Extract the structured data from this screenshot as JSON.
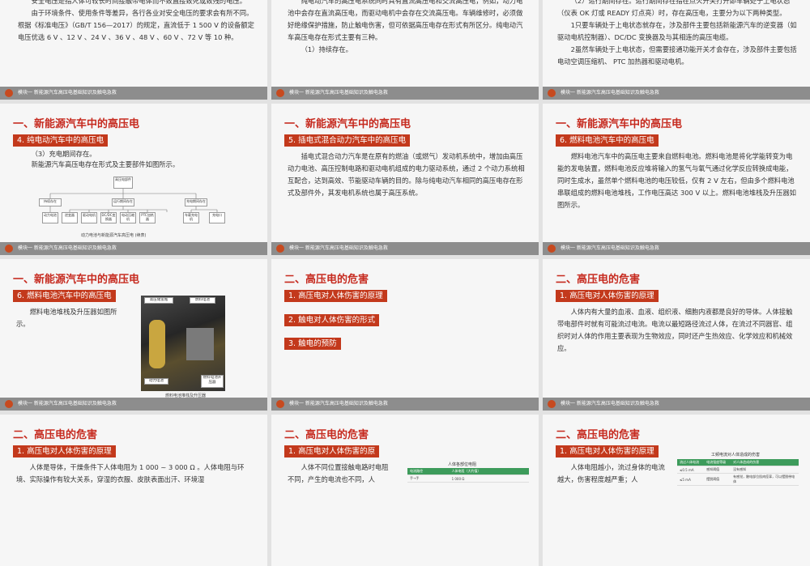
{
  "footer_text": "模块一 新能源汽车高压电基础知识及触电急救",
  "s1": {
    "p1": "安全电压是指人体可较长时间接触带电体而不致直接致死或致残的电压。",
    "p2": "由于环境条件、使用条件等差异，各行各业对安全电压的要求会有所不同。根据《标准电压》（GB/T 156—2017）的规定，直流低于 1 500 V 的设备额定电压优选 6 V 、12 V 、24 V 、36 V 、48 V 、60 V 、72 V 等 10 种。"
  },
  "s2": {
    "p1": "纯电动汽车的高压电系统同时具有直流高压电和交流高压电，例如，动力电池中会存在直流高压电，而驱动电机中会存在交流高压电。车辆维修时，必须做好绝缘保护措施，防止触电伤害，但可依据高压电存在形式有所区分。纯电动汽车高压电存在形式主要有三种。",
    "p2": "（1）持续存在。"
  },
  "s3": {
    "p1": "（2）运行期间存在。运行期间存在指在点火开关打开即车辆处于上电状态（仪表 OK 灯或 READY 灯点亮）时，存在高压电，主要分为以下两种类型。",
    "p2": "1只要车辆处于上电状态就存在，涉及部件主要包括新能源汽车的逆变器（如驱动电机控制器）、DC/DC 变换器及与其相连的高压电缆。",
    "p3": "2虽然车辆处于上电状态，但需要接通功能开关才会存在，涉及部件主要包括电动空调压缩机、 PTC 加热器和驱动电机。"
  },
  "s4": {
    "title": "一、新能源汽车中的高压电",
    "tag": "4. 纯电动汽车中的高压电",
    "p1": "（3）充电期间存在。",
    "p2": "新能源汽车高压电存在形式及主要部件如图所示。",
    "diagram": {
      "root": "高压电部件",
      "mid": [
        "持续存在",
        "运行期间存在",
        "充电期间存在"
      ],
      "leaf": [
        "动力电池",
        "逆变器",
        "驱动电机",
        "DC/DC变换器",
        "电动压缩机",
        "PTC加热器",
        "车载充电机",
        "充电口"
      ]
    },
    "caption": "动力电池与新能源汽车高压电 (续表)"
  },
  "s5": {
    "title": "一、新能源汽车中的高压电",
    "tag": "5. 插电式混合动力汽车中的高压电",
    "p1": "插电式混合动力汽车是在原有的燃油（或燃气）发动机系统中，增加由高压动力电池、高压控制电路和驱动电机组成的电力驱动系统，通过 2 个动力系统相互配合，达到高效、节能驱动车辆的目的。除与纯电动汽车相同的高压电存在形式及部件外，其发电机系统也属于高压系统。"
  },
  "s6": {
    "title": "一、新能源汽车中的高压电",
    "tag": "6. 燃料电池汽车中的高压电",
    "p1": "燃料电池汽车中的高压电主要来自燃料电池。燃料电池是将化学能转变为电能的发电装置，燃料电池反应堆将输入的氢气与氧气通过化学反应转换成电能，同时生成水，虽然单个燃料电池的电压较低，仅有 2 V 左右，但由多个燃料电池串联组成的燃料电池堆栈，工作电压高达 300 V 以上。燃料电池堆栈及升压器如图所示。"
  },
  "s7": {
    "title": "一、新能源汽车中的高压电",
    "tag": "6. 燃料电池汽车中的高压电",
    "p1": "燃料电池堆栈及升压器如图所示。",
    "labels": [
      "高压储氢瓶",
      "燃料电池",
      "动力电池",
      "燃料电池升压器"
    ],
    "caption": "燃料电池堆栈及升压器"
  },
  "s8": {
    "title": "二、高压电的危害",
    "items": [
      "1. 高压电对人体伤害的原理",
      "2. 触电对人体伤害的形式",
      "3. 触电的预防"
    ]
  },
  "s9": {
    "title": "二、高压电的危害",
    "tag": "1. 高压电对人体伤害的原理",
    "p1": "人体内有大量的血液、血液、组织液、细胞内液都是良好的导体。人体接触带电部件时就有可能流过电流。电流以最短路径流过人体，在流过不同器官、组织时对人体的作用主要表现为生物效应，同时还产生热效应、化学效应和机械效应。"
  },
  "s10": {
    "title": "二、高压电的危害",
    "tag": "1. 高压电对人体伤害的原理",
    "p1": "人体是导体，干燥条件下人体电阻为 1 000 ~ 3 000 Ω 。人体电阻与环境、实际操作有较大关系，穿湿的衣服、皮肤表面出汗、环境湿"
  },
  "s11": {
    "title": "二、高压电的危害",
    "tag": "1. 高压电对人体伤害的原",
    "p1": "人体不同位置接触电路时电阻不同，产生的电流也不同，人",
    "table_title": "人体各部位电阻",
    "headers": [
      "电流路径",
      "人体电阻（大约值）"
    ],
    "rows": [
      [
        "手→手",
        "1 000 Ω"
      ]
    ]
  },
  "s12": {
    "title": "二、高压电的危害",
    "tag": "1. 高压电对人体伤害的原理",
    "p1": "人体电阻越小，流过身体的电流越大，伤害程度越严重；人",
    "table_title": "工频电流对人体造成的伤害",
    "headers": [
      "流过人体电流",
      "电流强度等级",
      "对人体造成的伤害"
    ],
    "rows": [
      [
        "≤0.5 mA",
        "感知阈值",
        "没有感知"
      ],
      [
        "≤5 mA",
        "摆脱阈值",
        "有感觉，触电部位肌肉痉挛，可以摆脱带电体"
      ]
    ]
  }
}
